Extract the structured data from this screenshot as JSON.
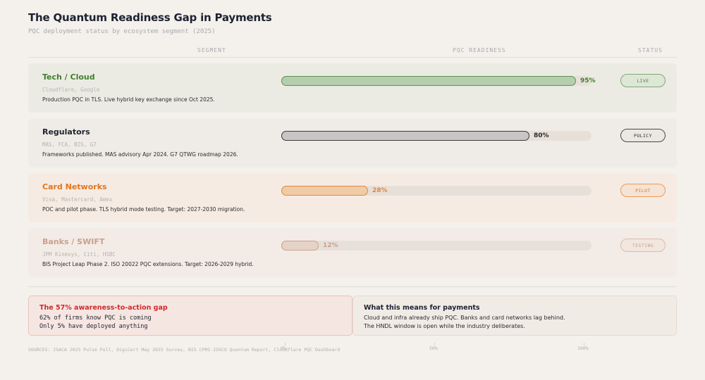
{
  "title": "The Quantum Readiness Gap in Payments",
  "subtitle": "PQC deployment status by ecosystem segment (2025)",
  "columns": {
    "segment": "SEGMENT",
    "readiness": "PQC READINESS",
    "status": "STATUS"
  },
  "chart_data": {
    "type": "bar",
    "orientation": "horizontal",
    "title": "The Quantum Readiness Gap in Payments",
    "subtitle": "PQC deployment status by ecosystem segment (2025)",
    "categories": [
      "Tech / Cloud",
      "Regulators",
      "Card Networks",
      "Banks / SWIFT"
    ],
    "values": [
      95,
      80,
      28,
      12
    ],
    "value_labels": [
      "95%",
      "80%",
      "28%",
      "12%"
    ],
    "xlim": [
      0,
      100
    ],
    "x_ticks": [
      "0%",
      "50%",
      "100%"
    ],
    "statuses": [
      "LIVE",
      "POLICY",
      "PILOT",
      "TESTING"
    ]
  },
  "rows": [
    {
      "name": "Tech / Cloud",
      "orgs": "Cloudflare, Google",
      "desc": "Production PQC in TLS. Live hybrid key exchange since Oct 2025.",
      "value": 95,
      "pct_label": "95%",
      "status": "LIVE",
      "colors": {
        "row_bg": "#ecebe3",
        "name": "#3f7f2e",
        "fill": "#b5cfae",
        "fill_border": "#5f8f57",
        "pct": "#3f7f2e",
        "badge_bg": "#dde7d6",
        "badge_border": "#7fa777",
        "badge_text": "#4f7f47"
      }
    },
    {
      "name": "Regulators",
      "orgs": "MAS, FCA, BIS, G7",
      "desc": "Frameworks published. MAS advisory Apr 2024. G7 QTWG roadmap 2026.",
      "value": 80,
      "pct_label": "80%",
      "status": "POLICY",
      "colors": {
        "row_bg": "#efebe6",
        "name": "#1f2430",
        "fill": "#c8c6c4",
        "fill_border": "#3a3a3a",
        "pct": "#2a2a2a",
        "badge_bg": "#ebe7e2",
        "badge_border": "#4a4a4a",
        "badge_text": "#2a2a2a"
      }
    },
    {
      "name": "Card Networks",
      "orgs": "Visa, Mastercard, Amex",
      "desc": "POC and pilot phase. TLS hybrid mode testing. Target: 2027-2030 migration.",
      "value": 28,
      "pct_label": "28%",
      "status": "PILOT",
      "colors": {
        "row_bg": "#f6ebe3",
        "name": "#e0761e",
        "fill": "#f0cba8",
        "fill_border": "#e0883a",
        "pct": "#e0883a",
        "badge_bg": "#f5e3d5",
        "badge_border": "#e89a5a",
        "badge_text": "#d47a30"
      }
    },
    {
      "name": "Banks / SWIFT",
      "orgs": "JPM Kinexys, Citi, HSBC",
      "desc": "BIS Project Leap Phase 2. ISO 20022 PQC extensions. Target: 2026-2029 hybrid.",
      "value": 12,
      "pct_label": "12%",
      "status": "TESTING",
      "colors": {
        "row_bg": "#f3ebe6",
        "name": "#c9a08c",
        "fill": "#e5d3c8",
        "fill_border": "#c9a08c",
        "pct": "#c9a08c",
        "badge_bg": "#f2e6df",
        "badge_border": "#dcbcad",
        "badge_text": "#c9a08c"
      }
    }
  ],
  "gap_card": {
    "title": "The 57% awareness-to-action gap",
    "line1": "62% of firms know PQC is coming",
    "line2": "Only 5% have deployed anything",
    "colors": {
      "bg": "#f6e6e2",
      "border": "#e7c2bb",
      "title": "#d02a2a"
    }
  },
  "meaning_card": {
    "title": "What this means for payments",
    "line1": "Cloud and infra already ship PQC. Banks and card networks lag behind.",
    "line2": "The HNDL window is open while the industry deliberates.",
    "colors": {
      "bg": "#f1ebe6",
      "border": "#e3dbd3",
      "title": "#1c2230"
    }
  },
  "sources": "SOURCES: ISACA 2025 Pulse Poll, DigiCert May 2025 Survey, BIS CPMI-IOSCO Quantum Report, Cloudflare PQC Dashboard",
  "axis_ticks": [
    "0%",
    "50%",
    "100%"
  ]
}
